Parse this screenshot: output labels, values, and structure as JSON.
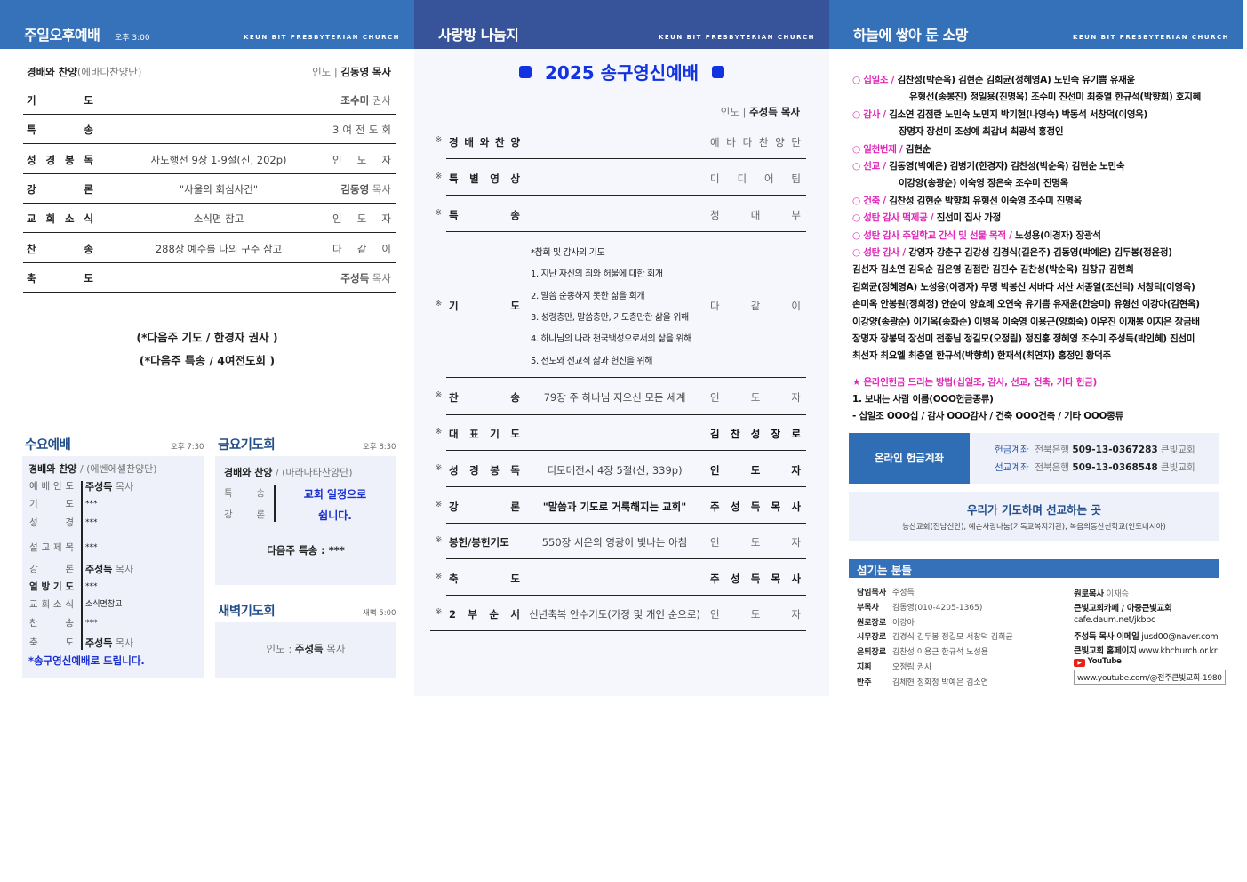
{
  "church_en": "KEUN BIT PRESBYTERIAN CHURCH",
  "left": {
    "title": "주일오후예배",
    "time": "오후 3:00",
    "head": {
      "label": "경배와 찬양",
      "sub": "(에바다찬양단)",
      "lead": "인도",
      "leader": "김동영",
      "leader_title": "목사"
    },
    "rows": [
      {
        "label": "기 도",
        "content": "",
        "name": "조수미",
        "title": "권사"
      },
      {
        "label": "특 송",
        "content": "",
        "right": "3 여 전 도 회"
      },
      {
        "label": "성 경 봉 독",
        "content": "사도행전 9장 1-9절(신, 202p)",
        "right": "인 도 자"
      },
      {
        "label": "강 론",
        "content": "\"사울의 회심사건\"",
        "name": "김동영",
        "title": "목사"
      },
      {
        "label": "교 회 소 식",
        "content": "소식면 참고",
        "right": "인 도 자"
      },
      {
        "label": "찬 송",
        "content": "288장 예수를 나의 구주 삼고",
        "right": "다 같 이"
      },
      {
        "label": "축 도",
        "content": "",
        "name": "주성득",
        "title": "목사"
      }
    ],
    "notes": [
      "(*다음주 기도 / 한경자 권사 )",
      "(*다음주 특송 / 4여전도회 )"
    ],
    "wed": {
      "title": "수요예배",
      "time": "오후 7:30",
      "head": "경배와 찬양",
      "sub": "/ (에벤에셀찬양단)",
      "rows": [
        {
          "label": "예 배 인 도",
          "name": "주성득",
          "title": "목사"
        },
        {
          "label": "기 도",
          "value": "***"
        },
        {
          "label": "성 경",
          "value": "***"
        },
        {
          "label": "설 교 제 목",
          "value": "***"
        },
        {
          "label": "강 론",
          "name": "주성득",
          "title": "목사"
        },
        {
          "label": "열 방 기 도",
          "value": "***"
        },
        {
          "label": "교 회 소 식",
          "value": "소식면참고"
        },
        {
          "label": "찬 송",
          "value": "***"
        },
        {
          "label": "축 도",
          "name": "주성득",
          "title": "목사"
        }
      ],
      "footer": "*송구영신예배로 드립니다."
    },
    "fri": {
      "title": "금요기도회",
      "time": "오후 8:30",
      "head": "경배와 찬양",
      "sub": "/ (마라나타찬양단)",
      "labels": [
        "특 송",
        "강 론"
      ],
      "msg1": "교회 일정으로",
      "msg2": "쉽니다.",
      "next": "다음주 특송 : ***"
    },
    "dawn": {
      "title": "새벽기도회",
      "time": "새벽 5:00",
      "lead": "인도 :",
      "name": "주성득",
      "title2": "목사"
    }
  },
  "middle": {
    "title": "사랑방 나눔지",
    "event": "2025 송구영신예배",
    "lead": "인도",
    "leader": "주성득 목사",
    "rows": [
      {
        "label": "경 배 와 찬 양",
        "content": "",
        "right": "에 바 다 찬 양 단"
      },
      {
        "label": "특 별 영 상",
        "content": "",
        "right": "미 디 어 팀"
      },
      {
        "label": "특 송",
        "content": "",
        "right": "청 대 부"
      },
      {
        "label": "기 도",
        "content": "",
        "right": "다 같 이"
      },
      {
        "label": "찬 송",
        "content": "79장 주 하나님 지으신 모든 세계",
        "right": "인 도 자"
      },
      {
        "label": "대 표 기 도",
        "content": "",
        "right": "김 찬 성 장 로"
      },
      {
        "label": "성 경 봉 독",
        "content": "디모데전서 4장 5절(신, 339p)",
        "right": "인 도 자"
      },
      {
        "label": "강 론",
        "content": "\"말씀과 기도로 거룩해지는 교회\"",
        "right": "주 성 득 목 사"
      },
      {
        "label": "봉헌/봉헌기도",
        "content": "550장 시온의 영광이 빛나는 아침",
        "right": "인 도 자"
      },
      {
        "label": "축 도",
        "content": "",
        "right": "주 성 득 목 사"
      },
      {
        "label": "2 부 순 서",
        "content": "신년축복 안수기도(가정 및 개인 순으로)",
        "right": "인 도 자"
      }
    ],
    "prayer": [
      "*참회 및 감사의 기도",
      "1. 지난 자신의 죄와 허물에 대한 회개",
      "2. 말씀 순종하지 못한 삶을 회개",
      "3. 성령충만, 말씀충만, 기도충만한 삶을 위해",
      "4. 하나님의 나라 천국백성으로서의 삶을 위해",
      "5. 전도와 선교적 삶과 헌신을 위해"
    ]
  },
  "right": {
    "title": "하늘에 쌓아 둔 소망",
    "offerings": [
      {
        "cat": "○ 십일조 /",
        "names": "김찬성(박순옥) 김현순 김희균(정혜영A) 노민숙 유기쁨 유재윤"
      },
      {
        "cat": "",
        "names": "유형선(송봉진) 정일용(진명옥) 조수미 진선미 최충열 한규석(박향희) 호지혜"
      },
      {
        "cat": "○ 감사 /",
        "names": "김소연 김점란 노민숙 노민지 박기현(나영숙) 박동석 서창덕(이영옥)"
      },
      {
        "cat": "",
        "names": "장명자 장선미 조성예 최갑녀 최광석 홍정인"
      },
      {
        "cat": "○ 일천번제 /",
        "names": "김현순"
      },
      {
        "cat": "○ 선교 /",
        "names": "김동영(박예은) 김병기(한경자) 김찬성(박순옥) 김현순 노민숙"
      },
      {
        "cat": "",
        "names": "이강양(송광순) 이숙영 장은숙 조수미 진명옥"
      },
      {
        "cat": "○ 건축 /",
        "names": "김찬성 김현순 박향희 유형선 이숙영 조수미 진명옥"
      },
      {
        "cat": "○ 성탄 감사 떡제공 /",
        "names": "진선미 집사 가정"
      },
      {
        "cat": "○ 성탄 감사 주일학교 간식 및 선물 목적 /",
        "names": "노성용(이경자) 장광석"
      },
      {
        "cat": "○ 성탄 감사 /",
        "names": "강영자 강춘구 김강성 김경식(길은주) 김동영(박예은) 김두봉(정윤정)"
      },
      {
        "cat": "",
        "names": "김선자 김소연 김옥순 김은영 김점란 김진수 김찬성(박순옥) 김창규 김현희"
      },
      {
        "cat": "",
        "names": "김희균(정혜영A) 노성용(이경자) 무명 박봉신 서바다 서산 서종열(조선덕) 서창덕(이영옥)"
      },
      {
        "cat": "",
        "names": "손미옥 안봉원(정희정) 안순이 양효례 오연숙 유기쁨 유재윤(한승미) 유형선 이강아(김현옥)"
      },
      {
        "cat": "",
        "names": "이강양(송광순) 이기옥(송화순) 이병옥 이숙영 이용근(양희숙) 이우진 이재봉 이지은 장금배"
      },
      {
        "cat": "",
        "names": "장명자 장봉덕 장선미 전종님 정길모(오정림) 정진홍 정혜영 조수미 주성득(박인혜) 진선미"
      },
      {
        "cat": "",
        "names": "최선자 최요엘 최충열 한규석(박향희) 한재석(최연자) 홍정인 황덕주"
      }
    ],
    "online_title": "★ 온라인헌금 드리는 방법(십일조, 감사, 선교, 건축, 기타 헌금)",
    "online_lines": [
      "1. 보내는 사람 이름(OOO헌금종류)",
      "- 십일조 OOO십 / 감사 OOO감사 / 건축 OOO건축 / 기타 OOO종류"
    ],
    "account_label": "온라인 헌금계좌",
    "accounts": [
      {
        "type": "헌금계좌",
        "bank": "전북은행",
        "number": "509-13-0367283",
        "holder": "큰빛교회"
      },
      {
        "type": "선교계좌",
        "bank": "전북은행",
        "number": "509-13-0368548",
        "holder": "큰빛교회"
      }
    ],
    "mission_title": "우리가 기도하며 선교하는 곳",
    "mission_text": "농산교회(전남신안), 예손사랑나눔(기독교복지기관),  복음의동산신학교(인도네시아)",
    "staff_title": "섬기는 분들",
    "staff": [
      {
        "role": "담임목사",
        "names": "주성득"
      },
      {
        "role": "부목사",
        "names": "김동영(010-4205-1365)"
      },
      {
        "role": "원로장로",
        "names": "이강아"
      },
      {
        "role": "시무장로",
        "names": "김경식 김두봉 정길모 서창덕 김희균"
      },
      {
        "role": "은퇴장로",
        "names": "김찬성 이용근 한규석 노성용"
      },
      {
        "role": "지휘",
        "names": "오정림 권사"
      },
      {
        "role": "반주",
        "names": "김체현 정회정 박예은 김소연"
      }
    ],
    "info": {
      "emeritus_role": "원로목사",
      "emeritus_name": "이재승",
      "cafe_label": "큰빛교회카페 / 아중큰빛교회",
      "cafe_url": "cafe.daum.net/jkbpc",
      "email_label": "주성득 목사 이메일",
      "email": "jusd00@naver.com",
      "home_label": "큰빛교회 홈페이지",
      "home": "www.kbchurch.or.kr",
      "youtube_logo": "YouTube",
      "youtube": "www.youtube.com/@전주큰빛교회-1980"
    }
  },
  "colors": {
    "header_left": "#3572b9",
    "header_mid": "#37539a",
    "header_right": "#3571b9",
    "pink": "#e024b5",
    "event_blue": "#1233e0"
  }
}
